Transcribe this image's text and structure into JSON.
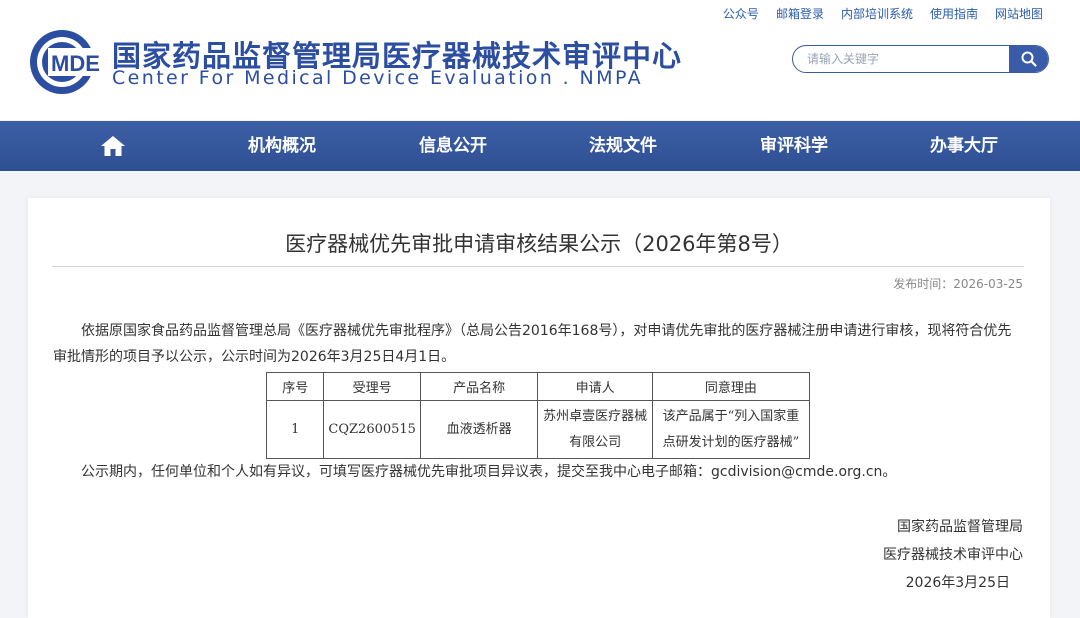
{
  "top_links": [
    "公众号",
    "邮箱登录",
    "内部培训系统",
    "使用指南",
    "网站地图"
  ],
  "logo": {
    "text": "MDE",
    "primary_color": "#2c4ea1"
  },
  "site": {
    "title_cn": "国家药品监督管理局医疗器械技术审评中心",
    "title_en": "Center For Medical Device Evaluation . NMPA"
  },
  "search": {
    "placeholder": "请输入关键字",
    "icon": "search-icon"
  },
  "nav": {
    "home_icon": "home-icon",
    "items": [
      "机构概况",
      "信息公开",
      "法规文件",
      "审评科学",
      "办事大厅"
    ]
  },
  "article": {
    "title": "医疗器械优先审批申请审核结果公示（2026年第8号）",
    "publish_label": "发布时间：2026-03-25",
    "intro": "依据原国家食品药品监督管理总局《医疗器械优先审批程序》（总局公告2016年168号），对申请优先审批的医疗器械注册申请进行审核，现将符合优先审批情形的项目予以公示，公示时间为2026年3月25日4月1日。",
    "table": {
      "headers": [
        "序号",
        "受理号",
        "产品名称",
        "申请人",
        "同意理由"
      ],
      "rows": [
        [
          "1",
          "CQZ2600515",
          "血液透析器",
          "苏州卓壹医疗器械有限公司",
          "该产品属于“列入国家重点研发计划的医疗器械”"
        ]
      ]
    },
    "notice": "公示期内，任何单位和个人如有异议，可填写医疗器械优先审批项目异议表，提交至我中心电子邮箱：gcdivision@cmde.org.cn。",
    "signature": {
      "org1": "国家药品监督管理局",
      "org2": "医疗器械技术审评中心",
      "date": "2026年3月25日"
    }
  },
  "colors": {
    "brand": "#2c4ea1",
    "nav_bg": "#34549a",
    "link": "#2b5cab"
  }
}
